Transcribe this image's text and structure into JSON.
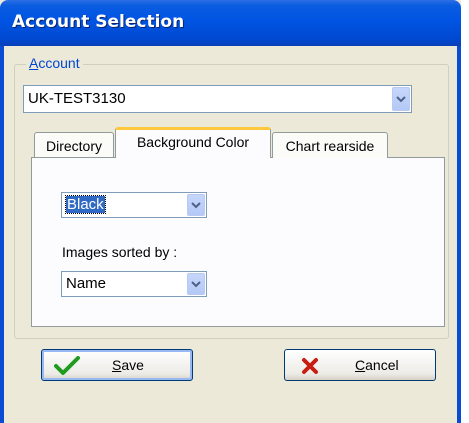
{
  "window": {
    "title": "Account Selection"
  },
  "account": {
    "group_label_accel": "A",
    "group_label_rest": "ccount",
    "selected": "UK-TEST3130"
  },
  "tabs": [
    {
      "label": "Directory",
      "active": false
    },
    {
      "label": "Background Color",
      "active": true
    },
    {
      "label": "Chart rearside",
      "active": false
    }
  ],
  "background_color": {
    "selected": "Black"
  },
  "images_sorted": {
    "label": "Images sorted by :",
    "selected": "Name"
  },
  "buttons": {
    "save_accel": "S",
    "save_rest": "ave",
    "cancel_accel": "C",
    "cancel_rest": "ancel"
  },
  "colors": {
    "titlebar": "#0054e3",
    "accent_tab": "#ffc73c",
    "save_check": "#1f9b1f",
    "cancel_x": "#c81e12",
    "selection": "#316ac5"
  }
}
